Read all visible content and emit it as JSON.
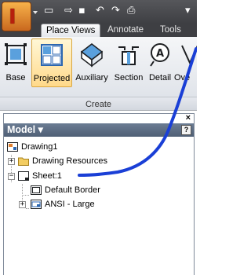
{
  "app": {
    "logo_letter": "I",
    "logo_icon": "inventor-app-icon"
  },
  "quick_access": [
    {
      "icon": "new-icon",
      "glyph": "▭"
    },
    {
      "icon": "open-icon",
      "glyph": "⇨"
    },
    {
      "icon": "save-icon",
      "glyph": "▪"
    },
    {
      "icon": "undo-icon",
      "glyph": "↶"
    },
    {
      "icon": "redo-icon",
      "glyph": "↷"
    },
    {
      "icon": "print-icon",
      "glyph": "⎙"
    },
    {
      "icon": "dropdown-icon",
      "glyph": "▾"
    }
  ],
  "tabs": [
    {
      "label": "Place Views",
      "active": true
    },
    {
      "label": "Annotate",
      "active": false
    },
    {
      "label": "Tools",
      "active": false
    }
  ],
  "ribbon": {
    "buttons": [
      {
        "label": "Base",
        "icon": "base-view-icon",
        "active": false
      },
      {
        "label": "Projected",
        "icon": "projected-view-icon",
        "active": true
      },
      {
        "label": "Auxiliary",
        "icon": "auxiliary-view-icon",
        "active": false
      },
      {
        "label": "Section",
        "icon": "section-view-icon",
        "active": false
      },
      {
        "label": "Detail",
        "icon": "detail-view-icon",
        "active": false
      },
      {
        "label": "Ove",
        "icon": "overlay-view-icon",
        "active": false
      }
    ],
    "group_label": "Create"
  },
  "browser": {
    "close_glyph": "×",
    "title": "Model ▾",
    "help_glyph": "?",
    "tree": [
      {
        "label": "Drawing1",
        "icon": "drawing-icon",
        "expander": ""
      },
      {
        "label": "Drawing Resources",
        "icon": "folder-icon",
        "expander": "+"
      },
      {
        "label": "Sheet:1",
        "icon": "sheet-icon",
        "expander": "−"
      },
      {
        "label": "Default Border",
        "icon": "border-icon",
        "expander": ""
      },
      {
        "label": "ANSI - Large",
        "icon": "title-block-icon",
        "expander": "+"
      }
    ]
  },
  "colors": {
    "pen_annotation": "#1a3fd6",
    "browser_header": "#5a6b82",
    "active_button": "#ffd98a",
    "app_icon": "#c9681e"
  }
}
